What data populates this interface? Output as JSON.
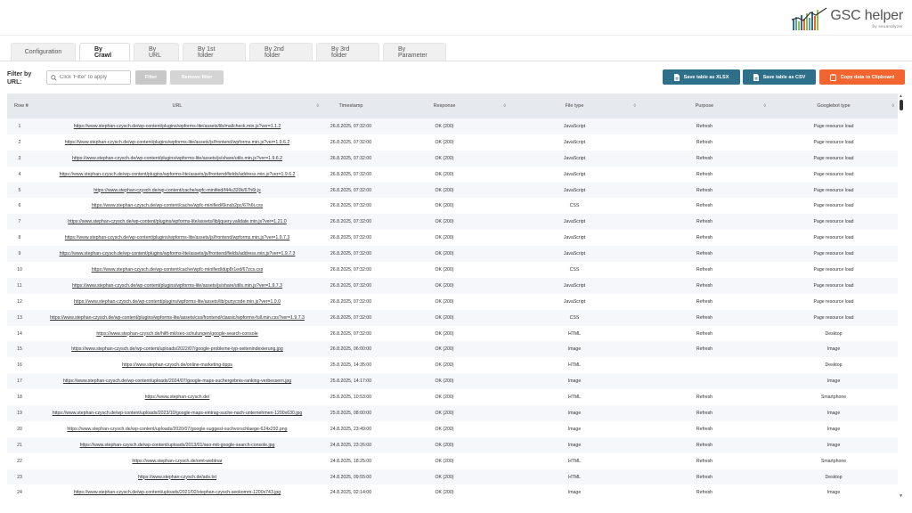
{
  "logo": {
    "title": "GSC helper",
    "subtitle": "by seoanalyzer"
  },
  "tabs": [
    {
      "label": "Configuration",
      "active": false
    },
    {
      "label": "By Crawl",
      "active": true
    },
    {
      "label": "By URL",
      "active": false
    },
    {
      "label": "By 1st folder",
      "active": false
    },
    {
      "label": "By 2nd folder",
      "active": false
    },
    {
      "label": "By 3rd folder",
      "active": false
    },
    {
      "label": "By Parameter",
      "active": false
    }
  ],
  "toolbar": {
    "filter_label": "Filter by URL:",
    "filter_placeholder": "Click 'Filter' to apply",
    "filter_button": "Filter",
    "remove_filter_button": "Remove filter",
    "save_xlsx": "Save table as XLSX",
    "save_csv": "Save table as CSV",
    "copy_clipboard": "Copy data to Clipboard"
  },
  "colors": {
    "accent": "#2e6f8a",
    "copy": "#f26430"
  },
  "table": {
    "headers": [
      "Row #",
      "URL",
      "Timestamp",
      "Response",
      "File type",
      "Purpose",
      "Googlebot type"
    ],
    "rows": [
      [
        "1",
        "https://www.stephan-czysch.de/wp-content/plugins/wpforms-lite/assets/lib/mailcheck.min.js?ver=1.1.2",
        "26.8.2025, 07:32:00",
        "OK (200)",
        "JavaScript",
        "Refresh",
        "Page resource load"
      ],
      [
        "2",
        "https://www.stephan-czysch.de/wp-content/plugins/wpforms-lite/assets/js/frontend/wpforms.min.js?ver=1.9.6.2",
        "26.8.2025, 07:32:00",
        "OK (200)",
        "JavaScript",
        "Refresh",
        "Page resource load"
      ],
      [
        "3",
        "https://www.stephan-czysch.de/wp-content/plugins/wpforms-lite/assets/js/share/utils.min.js?ver=1.9.6.2",
        "26.8.2025, 07:32:00",
        "OK (200)",
        "JavaScript",
        "Refresh",
        "Page resource load"
      ],
      [
        "4",
        "https://www.stephan-czysch.de/wp-content/plugins/wpforms-lite/assets/js/frontend/fields/address.min.js?ver=1.9.6.2",
        "26.8.2025, 07:32:00",
        "OK (200)",
        "JavaScript",
        "Refresh",
        "Page resource load"
      ],
      [
        "5",
        "https://www.stephan-czysch.de/wp-content/cache/wpfc-minified/f44u320k/67h6t.js",
        "26.8.2025, 07:32:00",
        "OK (200)",
        "JavaScript",
        "Refresh",
        "Page resource load"
      ],
      [
        "6",
        "https://www.stephan-czysch.de/wp-content/cache/wpfc-minified/6knsb2pc/67h6t.css",
        "26.8.2025, 07:32:00",
        "OK (200)",
        "CSS",
        "Refresh",
        "Page resource load"
      ],
      [
        "7",
        "https://www.stephan-czysch.de/wp-content/plugins/wpforms-lite/assets/lib/jquery.validate.min.js?ver=1.21.0",
        "26.8.2025, 07:32:00",
        "OK (200)",
        "JavaScript",
        "Refresh",
        "Page resource load"
      ],
      [
        "8",
        "https://www.stephan-czysch.de/wp-content/plugins/wpforms-lite/assets/js/frontend/wpforms.min.js?ver=1.9.7.3",
        "26.8.2025, 07:32:00",
        "OK (200)",
        "JavaScript",
        "Refresh",
        "Page resource load"
      ],
      [
        "9",
        "https://www.stephan-czysch.de/wp-content/plugins/wpforms-lite/assets/js/frontend/fields/address.min.js?ver=1.9.7.3",
        "26.8.2025, 07:32:00",
        "OK (200)",
        "JavaScript",
        "Refresh",
        "Page resource load"
      ],
      [
        "10",
        "https://www.stephan-czysch.de/wp-content/cache/wpfc-minified/dup8r1ed/67zcs.css",
        "26.8.2025, 07:32:00",
        "OK (200)",
        "CSS",
        "Refresh",
        "Page resource load"
      ],
      [
        "11",
        "https://www.stephan-czysch.de/wp-content/plugins/wpforms-lite/assets/js/share/utils.min.js?ver=1.9.7.3",
        "26.8.2025, 07:32:00",
        "OK (200)",
        "JavaScript",
        "Refresh",
        "Page resource load"
      ],
      [
        "12",
        "https://www.stephan-czysch.de/wp-content/plugins/wpforms-lite/assets/lib/punycode.min.js?ver=1.0.0",
        "26.8.2025, 07:32:00",
        "OK (200)",
        "JavaScript",
        "Refresh",
        "Page resource load"
      ],
      [
        "13",
        "https://www.stephan-czysch.de/wp-content/plugins/wpforms-lite/assets/css/frontend/classic/wpforms-full.min.css?ver=1.9.7.3",
        "26.8.2025, 07:32:00",
        "OK (200)",
        "CSS",
        "Refresh",
        "Page resource load"
      ],
      [
        "14",
        "https://www.stephan-czysch.de/hilft-mit/seo-schulungen/google-search-console",
        "26.8.2025, 07:32:00",
        "OK (200)",
        "HTML",
        "Refresh",
        "Desktop"
      ],
      [
        "15",
        "https://www.stephan-czysch.de/wp-content/uploads/2022/07/google-probleme-typ-seitenindexierung.jpg",
        "26.8.2025, 06:00:00",
        "OK (200)",
        "Image",
        "Refresh",
        "Image"
      ],
      [
        "16",
        "https://www.stephan-czysch.de/online-marketing-tipps",
        "25.8.2025, 14:35:00",
        "OK (200)",
        "HTML",
        "",
        "Desktop"
      ],
      [
        "17",
        "https://www.stephan-czysch.de/wp-content/uploads/2024/07/google-maps-suchergebnis-ranking-verbessern.jpg",
        "25.8.2025, 14:17:00",
        "OK (200)",
        "Image",
        "",
        "Image"
      ],
      [
        "18",
        "https://www.stephan-czysch.de/",
        "25.8.2025, 10:53:00",
        "OK (200)",
        "HTML",
        "Refresh",
        "Smartphone"
      ],
      [
        "19",
        "https://www.stephan-czysch.de/wp-content/uploads/2023/10/google-maps-eintrag-suche-nach-unternehmen-1200x630.jpg",
        "25.8.2025, 08:00:00",
        "OK (200)",
        "Image",
        "Refresh",
        "Image"
      ],
      [
        "20",
        "https://www.stephan-czysch.de/wp-content/uploads/2020/07/google-suggest-suchvorschlaege-624x292.png",
        "24.8.2025, 23:49:00",
        "OK (200)",
        "Image",
        "Refresh",
        "Image"
      ],
      [
        "21",
        "https://www.stephan-czysch.de/wp-content/uploads/2013/01/seo-mit-google-search-console.jpg",
        "24.8.2025, 23:26:00",
        "OK (200)",
        "Image",
        "Refresh",
        "Image"
      ],
      [
        "22",
        "https://www.stephan-czysch.de/omt-webinar",
        "24.8.2025, 18:25:00",
        "OK (200)",
        "HTML",
        "Refresh",
        "Smartphone"
      ],
      [
        "23",
        "https://www.stephan-czysch.de/ads.txt",
        "24.8.2025, 09:55:00",
        "OK (200)",
        "HTML",
        "Refresh",
        "Desktop"
      ],
      [
        "24",
        "https://www.stephan-czysch.de/wp-content/uploads/2021/02/stephan-czysch-seokomm-1200x743.jpg",
        "24.8.2025, 02:14:00",
        "OK (200)",
        "Image",
        "Refresh",
        "Image"
      ]
    ]
  }
}
